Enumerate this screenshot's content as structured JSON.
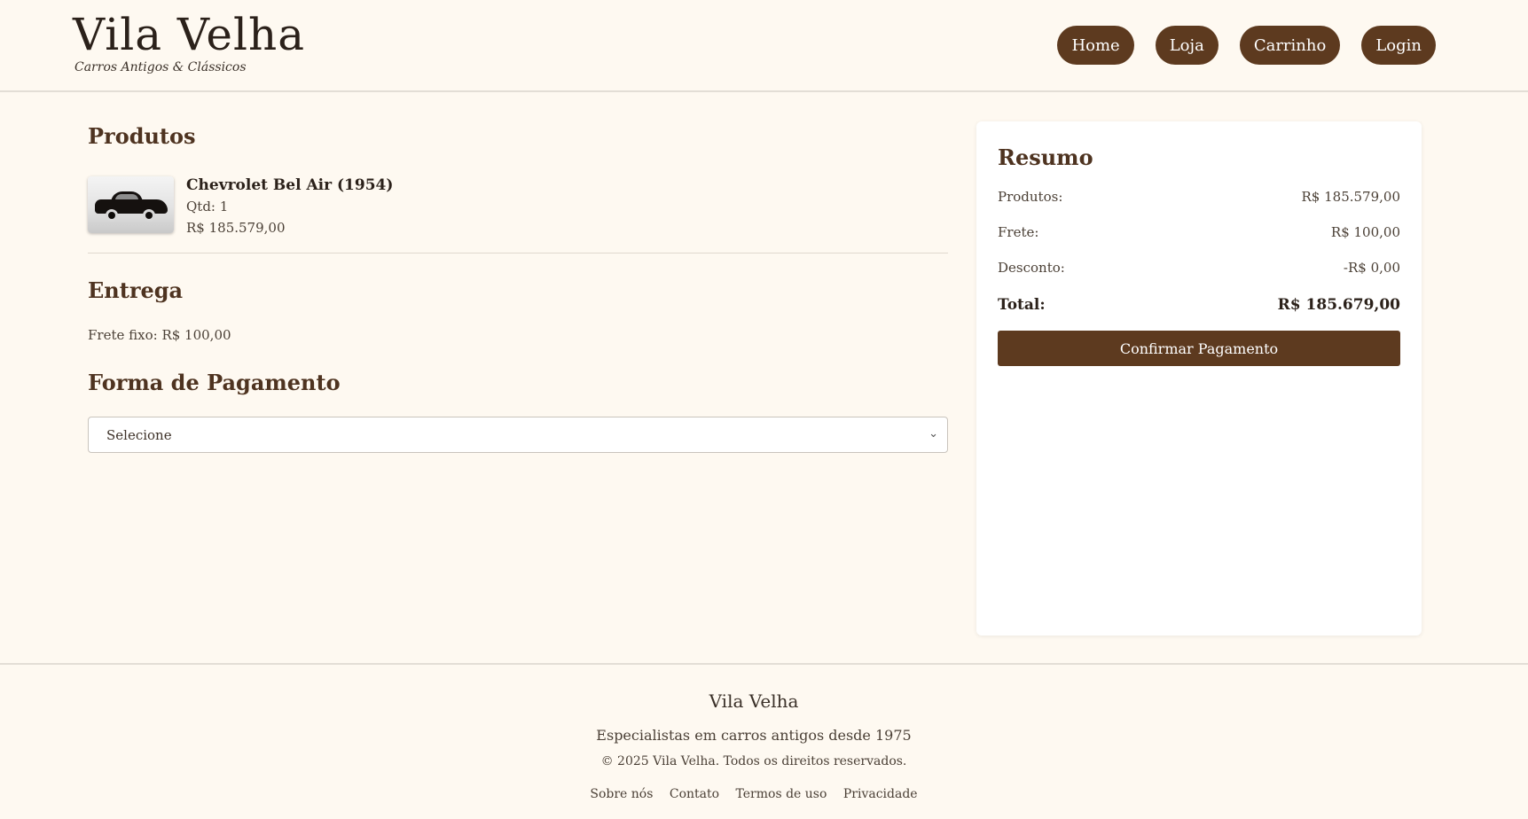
{
  "header": {
    "brand": "Vila Velha",
    "tagline": "Carros Antigos & Clássicos",
    "nav": [
      "Home",
      "Loja",
      "Carrinho",
      "Login"
    ]
  },
  "products_section": {
    "title": "Produtos",
    "items": [
      {
        "name": "Chevrolet Bel Air (1954)",
        "qty": "Qtd: 1",
        "price": "R$ 185.579,00",
        "image_alt": "car-photo"
      }
    ]
  },
  "delivery_section": {
    "title": "Entrega",
    "text": "Frete fixo: R$ 100,00"
  },
  "payment_section": {
    "title": "Forma de Pagamento",
    "select_value": "Selecione"
  },
  "summary": {
    "title": "Resumo",
    "rows": [
      {
        "label": "Produtos:",
        "value": "R$ 185.579,00"
      },
      {
        "label": "Frete:",
        "value": "R$ 100,00"
      },
      {
        "label": "Desconto:",
        "value": "-R$ 0,00"
      }
    ],
    "total_label": "Total:",
    "total_value": "R$ 185.679,00",
    "confirm_label": "Confirmar Pagamento"
  },
  "footer": {
    "title": "Vila Velha",
    "tagline": "Especialistas em carros antigos desde 1975",
    "copyright": "© 2025 Vila Velha. Todos os direitos reservados.",
    "links": [
      "Sobre nós",
      "Contato",
      "Termos de uso",
      "Privacidade"
    ]
  },
  "colors": {
    "background": "#fef9f1",
    "accent": "#5d3a1f",
    "heading": "#4e3320"
  }
}
